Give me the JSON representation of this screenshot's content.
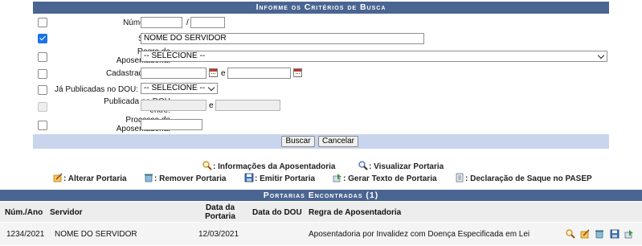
{
  "search": {
    "caption": "Informe os Critérios de Busca",
    "numero_ano": {
      "label": "Número/Ano:",
      "numero_value": "",
      "ano_value": "",
      "separator": "/",
      "checked": false
    },
    "servidor": {
      "label": "Servidor:",
      "value": "NOME DO SERVIDOR",
      "checked": true
    },
    "regra": {
      "label_line1": "Regra de",
      "label_line2": "Aposentadoria:",
      "selected": "-- SELECIONE --",
      "checked": false
    },
    "cadastrada": {
      "label": "Cadastrada entre:",
      "from": "",
      "to": "",
      "separator": "e",
      "checked": false
    },
    "publicadas": {
      "label": "Já Publicadas no DOU:",
      "selected": "-- SELECIONE --",
      "checked": false
    },
    "publicada_entre": {
      "label_line1": "Publicada no DOU",
      "label_line2": "entre:",
      "from": "",
      "to": "",
      "separator": "e",
      "checked": false,
      "disabled": true
    },
    "processo": {
      "label_line1": "Processo de",
      "label_line2": "Aposentadoria:",
      "value": "",
      "checked": false
    },
    "buttons": {
      "search": "Buscar",
      "cancel": "Cancelar"
    }
  },
  "legend": {
    "info": "Informações da Aposentadoria",
    "view": "Visualizar Portaria",
    "edit": "Alterar Portaria",
    "remove": "Remover Portaria",
    "emit": "Emitir Portaria",
    "text": "Gerar Texto de Portaria",
    "pasep": "Declaração de Saque no PASEP",
    "colon": ":"
  },
  "results": {
    "caption": "Portarias Encontradas (1)",
    "columns": {
      "num_ano": "Núm./Ano",
      "servidor": "Servidor",
      "data_portaria_1": "Data da",
      "data_portaria_2": "Portaria",
      "data_dou": "Data do DOU",
      "regra": "Regra de Aposentadoria"
    },
    "rows": [
      {
        "num_ano": "1234/2021",
        "servidor": "NOME DO SERVIDOR",
        "data_portaria": "12/03/2021",
        "data_dou": "",
        "regra": "Aposentadoria por Invalidez com Doença Especificada em Lei"
      }
    ]
  },
  "colors": {
    "header_bar": "#4a6591",
    "footer_bar": "#c8d5ec",
    "row_alt": "#f4f4f4",
    "checkbox_accent": "#1a73e8"
  },
  "icons": [
    "magnifier-icon",
    "magnifier-page-icon",
    "pencil-page-icon",
    "trash-icon",
    "save-icon",
    "text-generate-icon",
    "document-icon"
  ]
}
